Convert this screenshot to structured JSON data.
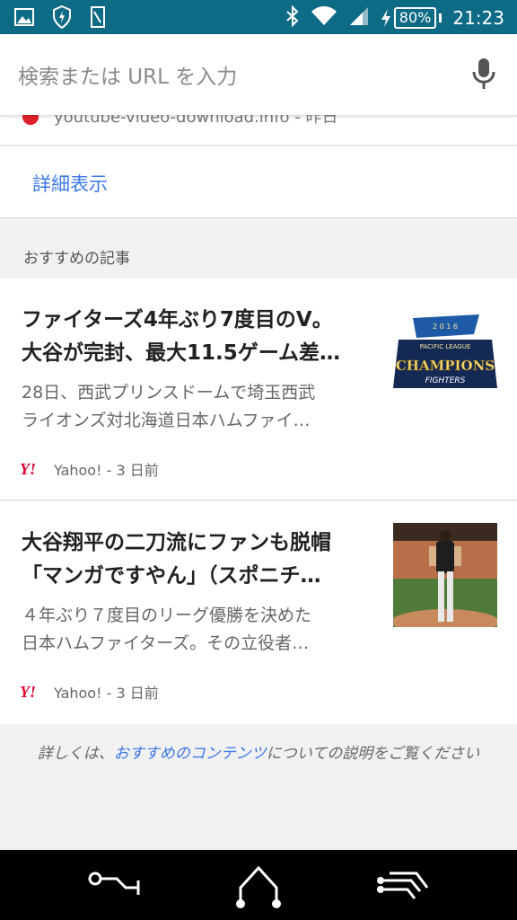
{
  "status_bar": {
    "time": "21:23",
    "battery_percent": "80%",
    "icons": [
      "image-icon",
      "shield-icon",
      "sd-card-icon",
      "bluetooth-icon",
      "wifi-icon",
      "cell-signal-icon",
      "charging-icon",
      "battery-icon"
    ]
  },
  "search": {
    "placeholder": "検索または URL を入力"
  },
  "history": {
    "partial_text": "youtube-video-download.info - 昨日"
  },
  "more_link": "詳細表示",
  "section_title": "おすすめの記事",
  "articles": [
    {
      "title_line1": "ファイターズ4年ぶり7度目のV。",
      "title_line2": "大谷が完封、最大11.5ゲーム差…",
      "snippet_line1": "28日、西武プリンスドームで埼玉西武",
      "snippet_line2": "ライオンズ対北海道日本ハムファイ…",
      "source": "Yahoo! - 3 日前",
      "thumb_text1": "2 0 1 6",
      "thumb_text2": "PACIFIC LEAGUE",
      "thumb_text3": "CHAMPIONS",
      "thumb_text4": "FIGHTERS"
    },
    {
      "title_line1": "大谷翔平の二刀流にファンも脱帽",
      "title_line2": "「マンガですやん」（スポニチ…",
      "snippet_line1": "４年ぶり７度目のリーグ優勝を決めた",
      "snippet_line2": "日本ハムファイターズ。その立役者…",
      "source": "Yahoo! - 3 日前"
    }
  ],
  "footer": {
    "prefix": "詳しくは、",
    "link": "おすすめのコンテンツ",
    "suffix": "についての説明をご覧ください"
  },
  "colors": {
    "status_bar": "#0e6b86",
    "link": "#3b78e7",
    "yahoo": "#e0002c"
  }
}
